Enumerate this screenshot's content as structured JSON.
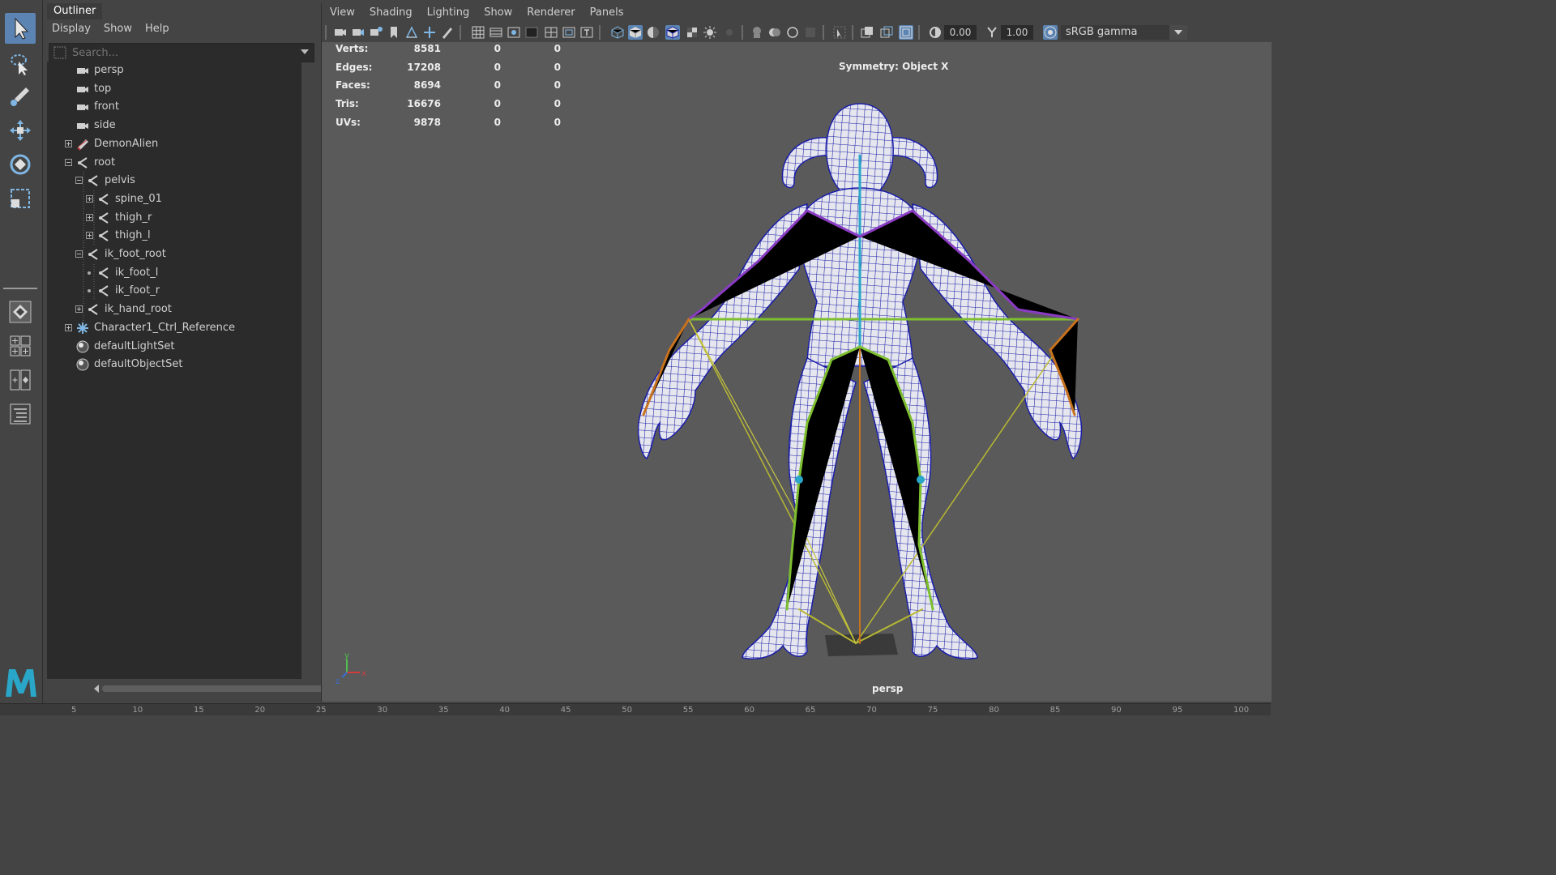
{
  "toolbox": {
    "tools": [
      "select-tool",
      "lasso-tool",
      "paint-select-tool",
      "move-tool",
      "rotate-tool",
      "scale-tool"
    ],
    "logo": "M"
  },
  "outliner": {
    "title": "Outliner",
    "menu": [
      "Display",
      "Show",
      "Help"
    ],
    "search_placeholder": "Search...",
    "items": [
      {
        "label": "persp",
        "icon": "camera-icon",
        "depth": 0,
        "expander": "none"
      },
      {
        "label": "top",
        "icon": "camera-icon",
        "depth": 0,
        "expander": "none"
      },
      {
        "label": "front",
        "icon": "camera-icon",
        "depth": 0,
        "expander": "none"
      },
      {
        "label": "side",
        "icon": "camera-icon",
        "depth": 0,
        "expander": "none"
      },
      {
        "label": "DemonAlien",
        "icon": "mesh-icon",
        "depth": 0,
        "expander": "plus"
      },
      {
        "label": "root",
        "icon": "joint-icon",
        "depth": 0,
        "expander": "minus"
      },
      {
        "label": "pelvis",
        "icon": "joint-icon",
        "depth": 1,
        "expander": "minus"
      },
      {
        "label": "spine_01",
        "icon": "joint-icon",
        "depth": 2,
        "expander": "plus"
      },
      {
        "label": "thigh_r",
        "icon": "joint-icon",
        "depth": 2,
        "expander": "plus"
      },
      {
        "label": "thigh_l",
        "icon": "joint-icon",
        "depth": 2,
        "expander": "plus"
      },
      {
        "label": "ik_foot_root",
        "icon": "joint-icon",
        "depth": 1,
        "expander": "minus"
      },
      {
        "label": "ik_foot_l",
        "icon": "joint-icon",
        "depth": 2,
        "expander": "dot"
      },
      {
        "label": "ik_foot_r",
        "icon": "joint-icon",
        "depth": 2,
        "expander": "dot"
      },
      {
        "label": "ik_hand_root",
        "icon": "joint-icon",
        "depth": 1,
        "expander": "plus"
      },
      {
        "label": "Character1_Ctrl_Reference",
        "icon": "hik-reference-icon",
        "depth": 0,
        "expander": "plus"
      },
      {
        "label": "defaultLightSet",
        "icon": "set-icon",
        "depth": 0,
        "expander": "none"
      },
      {
        "label": "defaultObjectSet",
        "icon": "set-icon",
        "depth": 0,
        "expander": "none"
      }
    ]
  },
  "viewport": {
    "menu": [
      "View",
      "Shading",
      "Lighting",
      "Show",
      "Renderer",
      "Panels"
    ],
    "exposure": "0.00",
    "gamma": "1.00",
    "color_space": "sRGB gamma",
    "symmetry": "Symmetry: Object X",
    "camera": "persp",
    "axis_labels": {
      "x": "x",
      "y": "y",
      "z": "z"
    },
    "stats": [
      {
        "label": "Verts:",
        "value": "8581",
        "selected": "0",
        "component": "0"
      },
      {
        "label": "Edges:",
        "value": "17208",
        "selected": "0",
        "component": "0"
      },
      {
        "label": "Faces:",
        "value": "8694",
        "selected": "0",
        "component": "0"
      },
      {
        "label": "Tris:",
        "value": "16676",
        "selected": "0",
        "component": "0"
      },
      {
        "label": "UVs:",
        "value": "9878",
        "selected": "0",
        "component": "0"
      }
    ]
  },
  "timeslider": {
    "ticks": [
      "5",
      "10",
      "15",
      "20",
      "25",
      "30",
      "35",
      "40",
      "45",
      "50",
      "55",
      "60",
      "65",
      "70",
      "75",
      "80",
      "85",
      "90",
      "95",
      "100"
    ]
  },
  "colors": {
    "selected": "#5b84b3",
    "wire": "#1a1ea8",
    "bone_green": "#7dbf2f",
    "bone_purple": "#8a3bc4",
    "bone_orange": "#c8721e",
    "ik_yellow": "#b8b832"
  }
}
